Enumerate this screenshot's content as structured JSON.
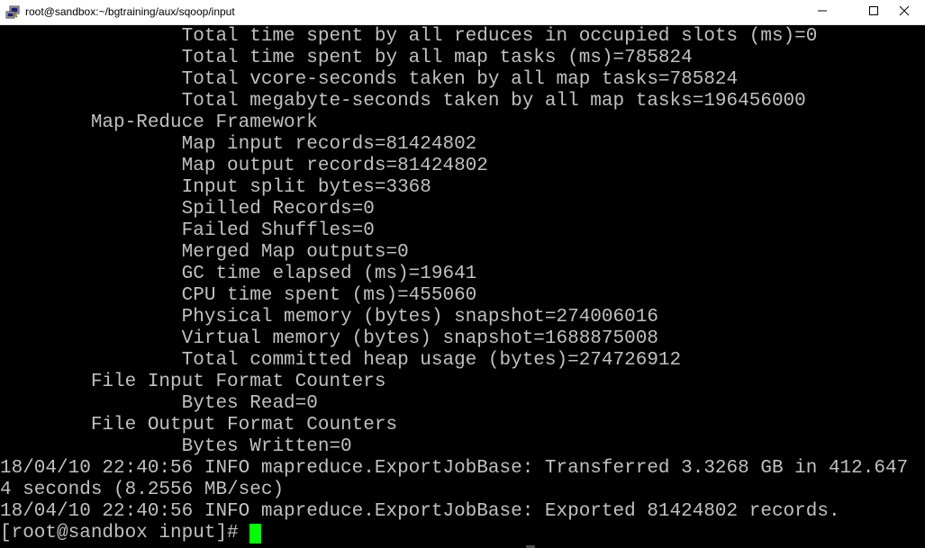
{
  "window": {
    "title": "root@sandbox:~/bgtraining/aux/sqoop/input",
    "icon": "putty-terminal-icon",
    "controls": {
      "minimize_icon": "minimize-icon",
      "maximize_icon": "maximize-icon",
      "close_icon": "close-icon"
    }
  },
  "terminal": {
    "background": "#000000",
    "foreground": "#c0c0c0",
    "cursor_color": "#00ff00",
    "lines": [
      "                Total time spent by all reduces in occupied slots (ms)=0",
      "                Total time spent by all map tasks (ms)=785824",
      "                Total vcore-seconds taken by all map tasks=785824",
      "                Total megabyte-seconds taken by all map tasks=196456000",
      "        Map-Reduce Framework",
      "                Map input records=81424802",
      "                Map output records=81424802",
      "                Input split bytes=3368",
      "                Spilled Records=0",
      "                Failed Shuffles=0",
      "                Merged Map outputs=0",
      "                GC time elapsed (ms)=19641",
      "                CPU time spent (ms)=455060",
      "                Physical memory (bytes) snapshot=274006016",
      "                Virtual memory (bytes) snapshot=1688875008",
      "                Total committed heap usage (bytes)=274726912",
      "        File Input Format Counters",
      "                Bytes Read=0",
      "        File Output Format Counters",
      "                Bytes Written=0",
      "18/04/10 22:40:56 INFO mapreduce.ExportJobBase: Transferred 3.3268 GB in 412.647",
      "4 seconds (8.2556 MB/sec)",
      "18/04/10 22:40:56 INFO mapreduce.ExportJobBase: Exported 81424802 records."
    ],
    "prompt": "[root@sandbox input]#"
  }
}
